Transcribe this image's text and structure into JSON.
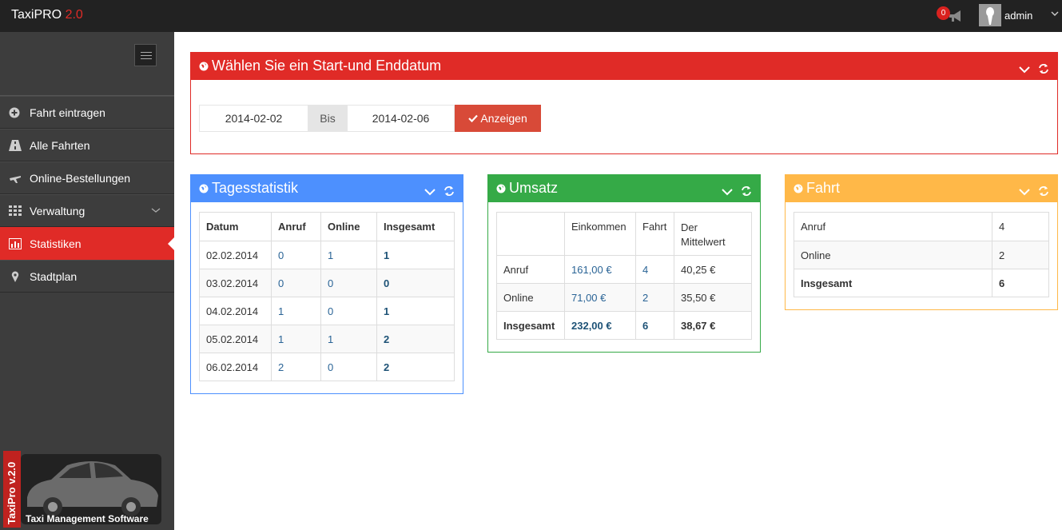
{
  "app": {
    "name": "TaxiPRO",
    "version": "2.0"
  },
  "header": {
    "notifications": "0",
    "user": "admin"
  },
  "sidebar": {
    "items": [
      {
        "label": "Fahrt eintragen",
        "icon": "plus-circle-icon"
      },
      {
        "label": "Alle Fahrten",
        "icon": "road-icon"
      },
      {
        "label": "Online-Bestellungen",
        "icon": "plane-icon"
      },
      {
        "label": "Verwaltung",
        "icon": "grid-icon"
      },
      {
        "label": "Statistiken",
        "icon": "bar-chart-icon"
      },
      {
        "label": "Stadtplan",
        "icon": "map-marker-icon"
      }
    ],
    "logo_side": "TaxiPro v.2.0",
    "logo_caption": "Taxi Management Software"
  },
  "date_panel": {
    "title": "Wählen Sie ein Start-und Enddatum",
    "start": "2014-02-02",
    "sep": "Bis",
    "end": "2014-02-06",
    "button": "Anzeigen"
  },
  "tages": {
    "title": "Tagesstatistik",
    "headers": [
      "Datum",
      "Anruf",
      "Online",
      "Insgesamt"
    ],
    "rows": [
      [
        "02.02.2014",
        "0",
        "1",
        "1"
      ],
      [
        "03.02.2014",
        "0",
        "0",
        "0"
      ],
      [
        "04.02.2014",
        "1",
        "0",
        "1"
      ],
      [
        "05.02.2014",
        "1",
        "1",
        "2"
      ],
      [
        "06.02.2014",
        "2",
        "0",
        "2"
      ]
    ]
  },
  "umsatz": {
    "title": "Umsatz",
    "headers": [
      "",
      "Einkommen",
      "Fahrt",
      "Der",
      "Mittelwert"
    ],
    "rows": [
      [
        "Anruf",
        "161,00 €",
        "4",
        "40,25 €"
      ],
      [
        "Online",
        "71,00 €",
        "2",
        "35,50 €"
      ],
      [
        "Insgesamt",
        "232,00 €",
        "6",
        "38,67 €"
      ]
    ]
  },
  "fahrt": {
    "title": "Fahrt",
    "rows": [
      [
        "Anruf",
        "4"
      ],
      [
        "Online",
        "2"
      ],
      [
        "Insgesamt",
        "6"
      ]
    ]
  },
  "colors": {
    "red": "#e02b27",
    "blue": "#4d90fe",
    "green": "#35aa47",
    "yellow": "#ffb848"
  }
}
